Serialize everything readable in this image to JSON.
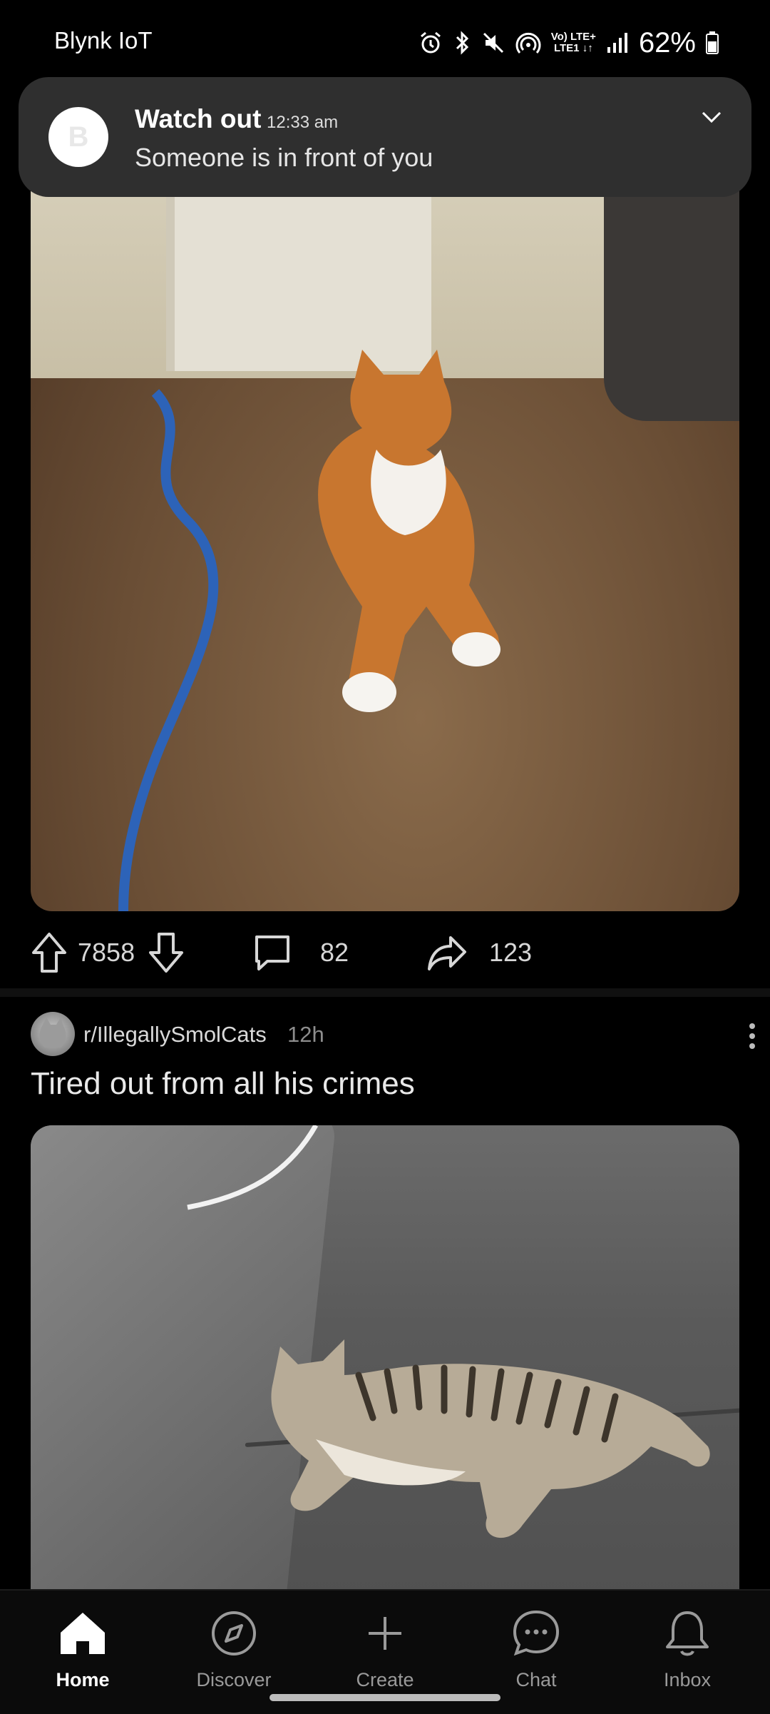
{
  "status_bar": {
    "app_name": "Blynk IoT",
    "battery": "62%",
    "network_line1": "Vo) LTE+",
    "network_line2": "LTE1 ↓↑"
  },
  "notification": {
    "avatar_letter": "B",
    "title": "Watch out",
    "time": "12:33 am",
    "body": "Someone is in front of you"
  },
  "post1": {
    "upvotes": "7858",
    "comments": "82",
    "shares": "123"
  },
  "post2": {
    "subreddit": "r/IllegallySmolCats",
    "age": "12h",
    "title": "Tired out from all his crimes"
  },
  "bottom_nav": {
    "items": [
      {
        "label": "Home",
        "icon": "home-icon",
        "active": true
      },
      {
        "label": "Discover",
        "icon": "compass-icon",
        "active": false
      },
      {
        "label": "Create",
        "icon": "plus-icon",
        "active": false
      },
      {
        "label": "Chat",
        "icon": "chat-bubble-icon",
        "active": false
      },
      {
        "label": "Inbox",
        "icon": "bell-icon",
        "active": false
      }
    ]
  },
  "colors": {
    "background": "#000000",
    "notification_bg": "#2f2f2f",
    "text_primary": "#ffffff",
    "text_secondary": "#8d8d8d"
  }
}
